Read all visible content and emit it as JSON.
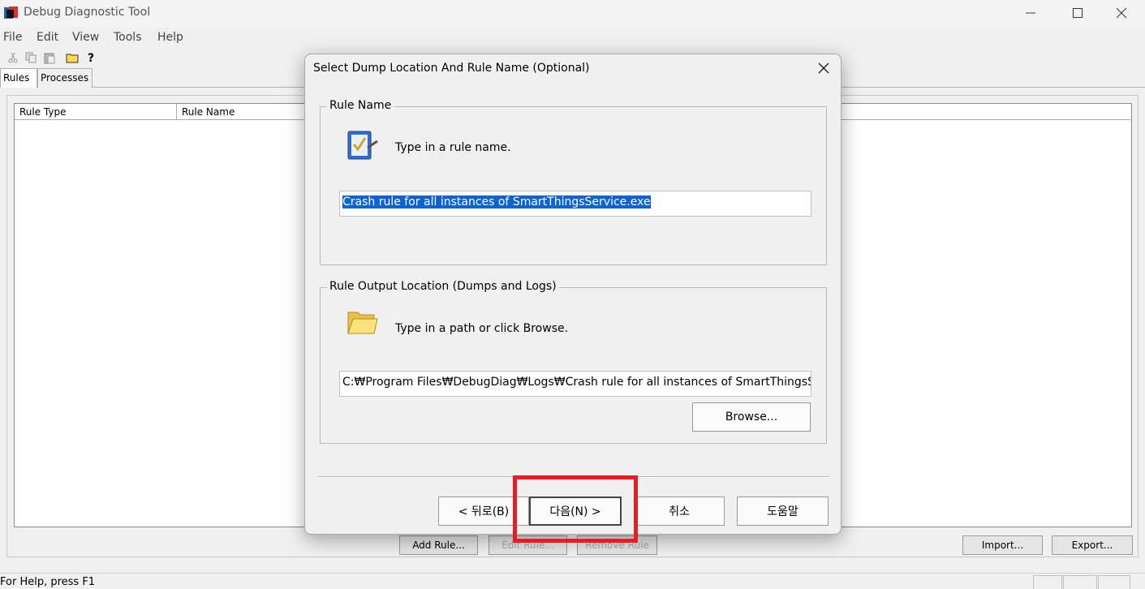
{
  "window": {
    "title": "Debug Diagnostic Tool"
  },
  "menu": [
    "File",
    "Edit",
    "View",
    "Tools",
    "Help"
  ],
  "toolbar_icons": [
    "cut-icon",
    "copy-icon",
    "paste-icon",
    "open-folder-icon",
    "help-pointer-icon"
  ],
  "tabs": [
    "Rules",
    "Processes"
  ],
  "list": {
    "columns": [
      "Rule Type",
      "Rule Name"
    ]
  },
  "bottom_buttons": {
    "add": "Add Rule...",
    "edit": "Edit Rule...",
    "remove": "Remove Rule",
    "import": "Import...",
    "export": "Export..."
  },
  "status": {
    "text": "For Help, press F1"
  },
  "dialog": {
    "title": "Select Dump Location And Rule Name (Optional)",
    "rule_name_group": "Rule Name",
    "rule_name_prompt": "Type in a rule name.",
    "rule_name_value": "Crash rule for all instances of SmartThingsService.exe",
    "output_group": "Rule Output Location (Dumps and Logs)",
    "output_prompt": "Type in a path or click Browse.",
    "output_value": "C:₩Program Files₩DebugDiag₩Logs₩Crash rule for all instances of SmartThingsServ",
    "browse": "Browse...",
    "back": "< 뒤로(B)",
    "next": "다음(N) >",
    "cancel": "취소",
    "help": "도움말"
  },
  "colors": {
    "highlight": "#e81c23",
    "selection": "#0a64d8"
  }
}
